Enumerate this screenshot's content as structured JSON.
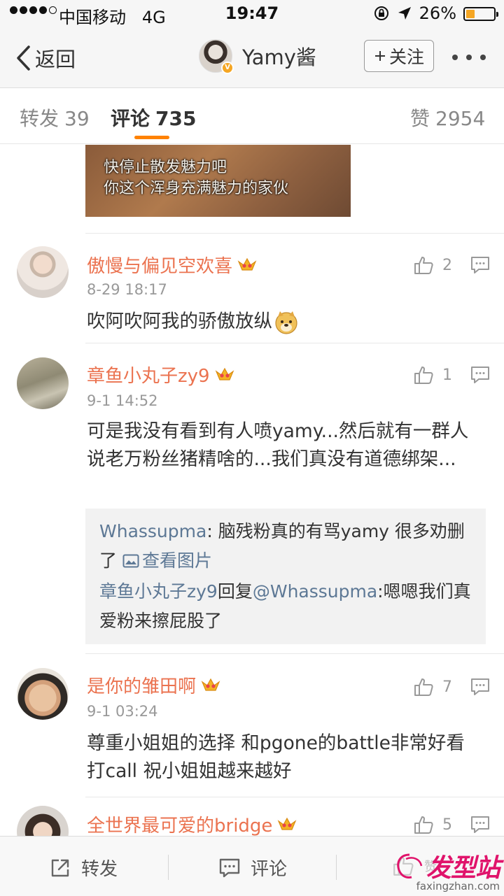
{
  "status_bar": {
    "carrier": "中国移动",
    "network": "4G",
    "time": "19:47",
    "battery": "26%"
  },
  "nav": {
    "back_label": "返回",
    "user_name": "Yamy酱",
    "follow_label": "关注"
  },
  "tabs": {
    "repost_label": "转发",
    "repost_count": "39",
    "comment_label": "评论",
    "comment_count": "735",
    "like_label": "赞",
    "like_count": "2954",
    "active": "comment"
  },
  "image_caption": [
    "快停止散发魅力吧",
    "你这个浑身充满魅力的家伙"
  ],
  "comments": [
    {
      "name": "傲慢与偏见空欢喜",
      "time": "8-29 18:17",
      "likes": "2",
      "text": "吹阿吹阿我的骄傲放纵"
    },
    {
      "name": "章鱼小丸子zy9",
      "time": "9-1 14:52",
      "likes": "1",
      "text": "可是我没有看到有人喷yamy...然后就有一群人说老万粉丝猪精啥的...我们真没有道德绑架...",
      "replies": [
        {
          "user": "Whassupma",
          "sep": ": ",
          "text": "脑残粉真的有骂yamy 很多劝删了 ",
          "link": "查看图片"
        },
        {
          "user": "章鱼小丸子zy9",
          "mid": "回复",
          "target": "@Whassupma",
          "text": ":嗯嗯我们真爱粉来擦屁股了"
        }
      ]
    },
    {
      "name": "是你的雏田啊",
      "time": "9-1 03:24",
      "likes": "7",
      "text": "尊重小姐姐的选择 和pgone的battle非常好看 打call  祝小姐姐越来越好"
    },
    {
      "name": "全世界最可爱的bridge",
      "time": "",
      "likes": "5",
      "text": ""
    }
  ],
  "bottom_bar": {
    "repost": "转发",
    "comment": "评论",
    "like": "赞"
  },
  "watermark": {
    "brand": "发型站",
    "domain": "faxingzhan.com"
  },
  "colors": {
    "accent": "#ff8200",
    "username": "#eb7350",
    "link": "#5d7895"
  }
}
